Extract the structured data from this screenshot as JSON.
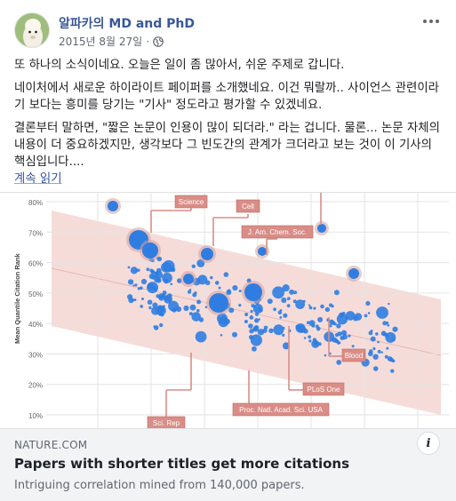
{
  "post": {
    "author": "알파카의 MD and PhD",
    "date": "2015년 8월 27일",
    "privacy_icon": "globe-icon",
    "paragraphs": [
      "또 하나의 소식이네요. 오늘은 일이 좀 많아서, 쉬운 주제로 갑니다.",
      "네이처에서 새로운 하이라이트 페이퍼를 소개했네요. 이건 뭐랄까.. 사이언스 관련이라기 보다는 흥미를 당기는 \"기사\" 정도라고 평가할 수 있겠네요.",
      "결론부터 말하면, \"짧은 논문이 인용이 많이 되더라.\" 라는 겁니다. 물론... 논문 자체의 내용이 더 중요하겠지만, 생각보다 그 빈도간의 관계가 크더라고 보는 것이 이 기사의 핵심입니다...."
    ],
    "read_more": "계속 읽기"
  },
  "link": {
    "source": "NATURE.COM",
    "title": "Papers with shorter titles get more citations",
    "description": "Intriguing correlation mined from 140,000 papers.",
    "info_label": "i"
  },
  "chart_data": {
    "type": "scatter",
    "ylabel": "Mean Quantile Citation Rank",
    "yticks": [
      "80%",
      "70%",
      "60%",
      "50%",
      "40%",
      "30%",
      "20%",
      "10%"
    ],
    "annotations": [
      "Science",
      "Cell",
      "J. Am. Chem. Soc.",
      "Blood",
      "PLoS One",
      "Proc. Natl. Acad. Sci. USA",
      "Sci. Rep"
    ],
    "colors": {
      "point": "#2f7de1",
      "band": "#f6dcd9",
      "label_bg": "#d98d87",
      "grid": "#e3e3e3"
    }
  }
}
